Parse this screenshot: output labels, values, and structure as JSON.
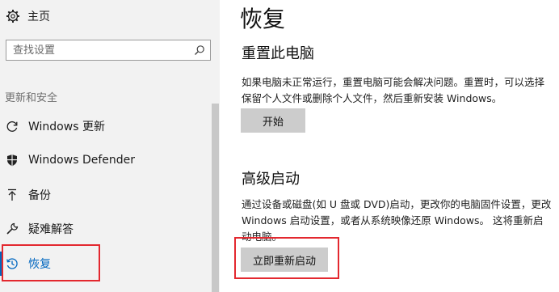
{
  "sidebar": {
    "home_label": "主页",
    "search_placeholder": "查找设置",
    "section_label": "更新和安全",
    "items": [
      {
        "label": "Windows 更新",
        "icon": "refresh-icon"
      },
      {
        "label": "Windows Defender",
        "icon": "shield-icon"
      },
      {
        "label": "备份",
        "icon": "backup-arrow-icon"
      },
      {
        "label": "疑难解答",
        "icon": "wrench-icon"
      },
      {
        "label": "恢复",
        "icon": "history-icon",
        "active": true
      }
    ]
  },
  "main": {
    "title": "恢复",
    "reset": {
      "title": "重置此电脑",
      "description": "如果电脑未正常运行，重置电脑可能会解决问题。重置时，可以选择保留个人文件或删除个人文件，然后重新安装 Windows。",
      "button": "开始"
    },
    "advanced": {
      "title": "高级启动",
      "description": "通过设备或磁盘(如 U 盘或 DVD)启动，更改你的电脑固件设置，更改 Windows 启动设置，或者从系统映像还原 Windows。 这将重新启动电脑。",
      "button": "立即重新启动"
    }
  },
  "colors": {
    "accent": "#0067c0",
    "highlight": "#e3282f",
    "sidebar_bg": "#f2f2f2",
    "button_bg": "#cccccc"
  }
}
